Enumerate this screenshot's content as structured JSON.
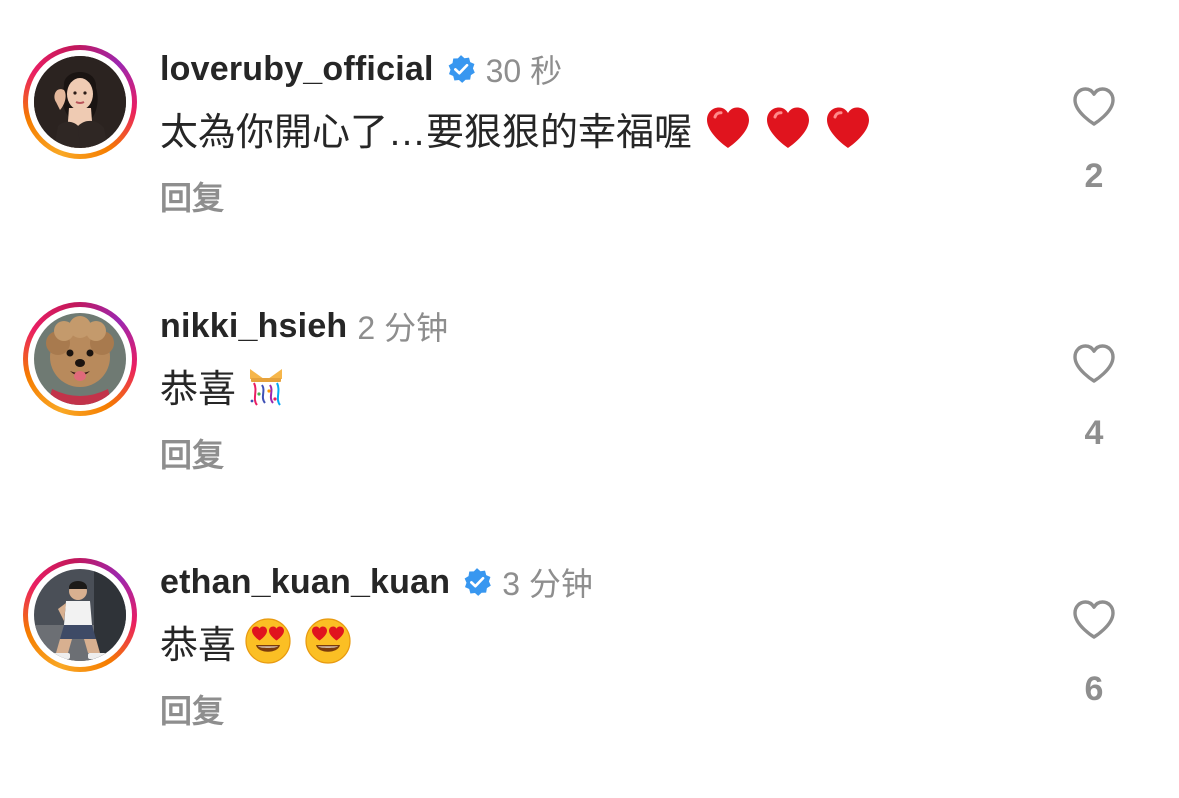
{
  "comments": [
    {
      "username": "loveruby_official",
      "verified": true,
      "time": "30 秒",
      "text": "太為你開心了…要狠狠的幸福喔",
      "emojis": [
        "red-heart",
        "red-heart",
        "red-heart"
      ],
      "reply_label": "回复",
      "likes": "2"
    },
    {
      "username": "nikki_hsieh",
      "verified": false,
      "time": "2 分钟",
      "text": "恭喜",
      "emojis": [
        "confetti-gift"
      ],
      "reply_label": "回复",
      "likes": "4"
    },
    {
      "username": "ethan_kuan_kuan",
      "verified": true,
      "time": "3 分钟",
      "text": "恭喜",
      "emojis": [
        "heart-eyes-face",
        "heart-eyes-face"
      ],
      "reply_label": "回复",
      "likes": "6"
    }
  ],
  "colors": {
    "text": "#262626",
    "muted": "#8e8e8e",
    "verified": "#3897f0",
    "heart": "#e0141e"
  }
}
